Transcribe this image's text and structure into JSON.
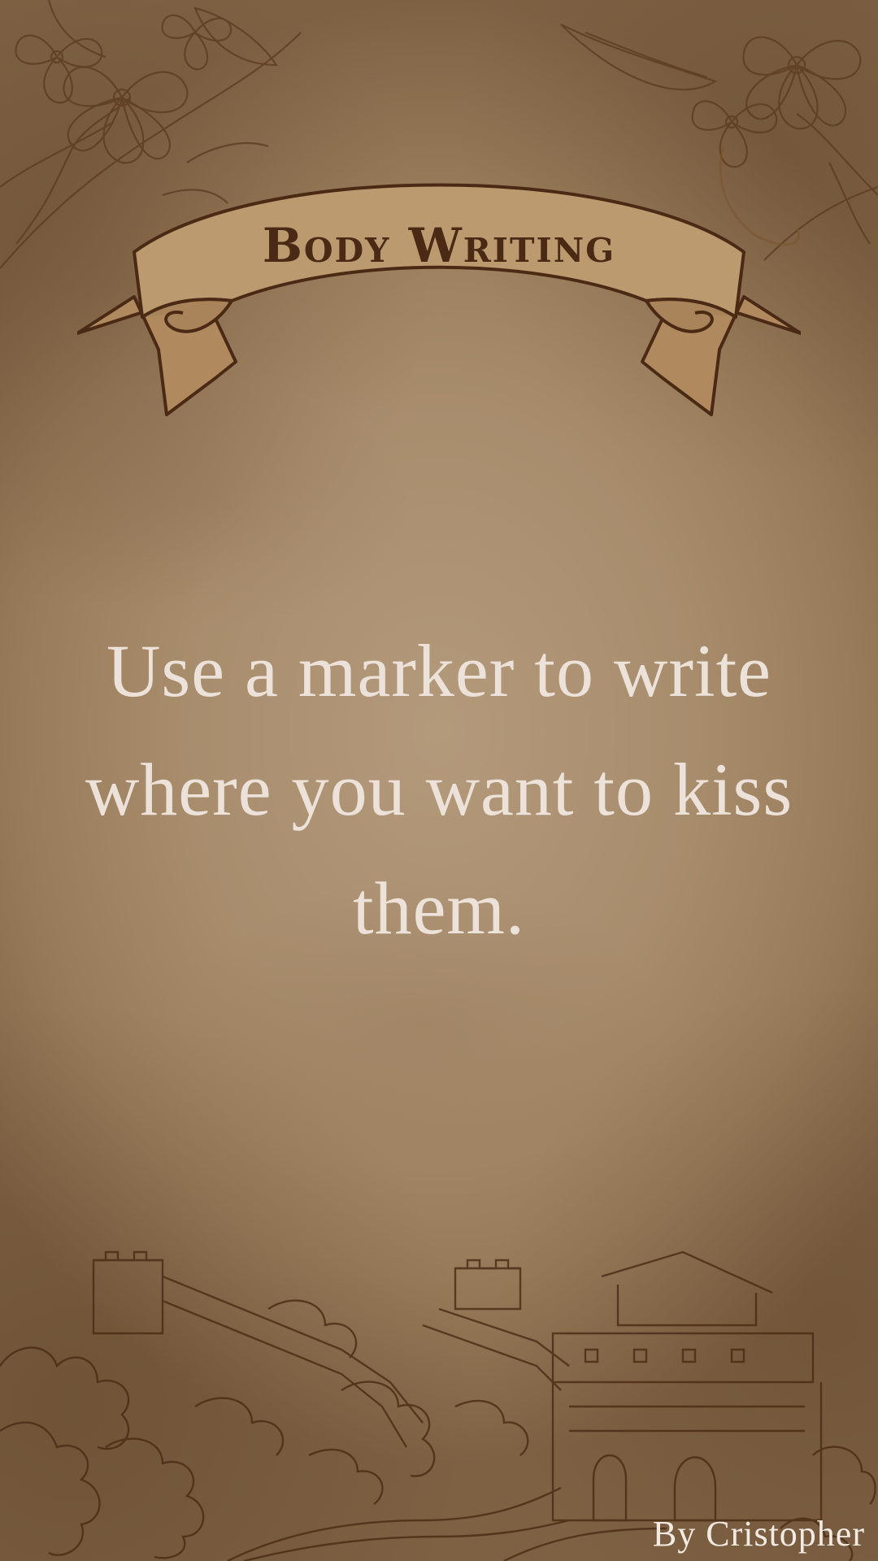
{
  "title": "Body Writing",
  "message": "Use a marker to write where you want to kiss them.",
  "author": "By Cristopher",
  "colors": {
    "background": "#a88d6d",
    "banner_fill": "#b8956b",
    "ink": "#4a2a14",
    "message_text": "#ece2d9"
  },
  "icons": {
    "top_left": "flower-sketch-icon",
    "top_right": "flower-sketch-icon",
    "banner": "ribbon-banner-icon",
    "bottom": "great-wall-sketch-icon"
  }
}
